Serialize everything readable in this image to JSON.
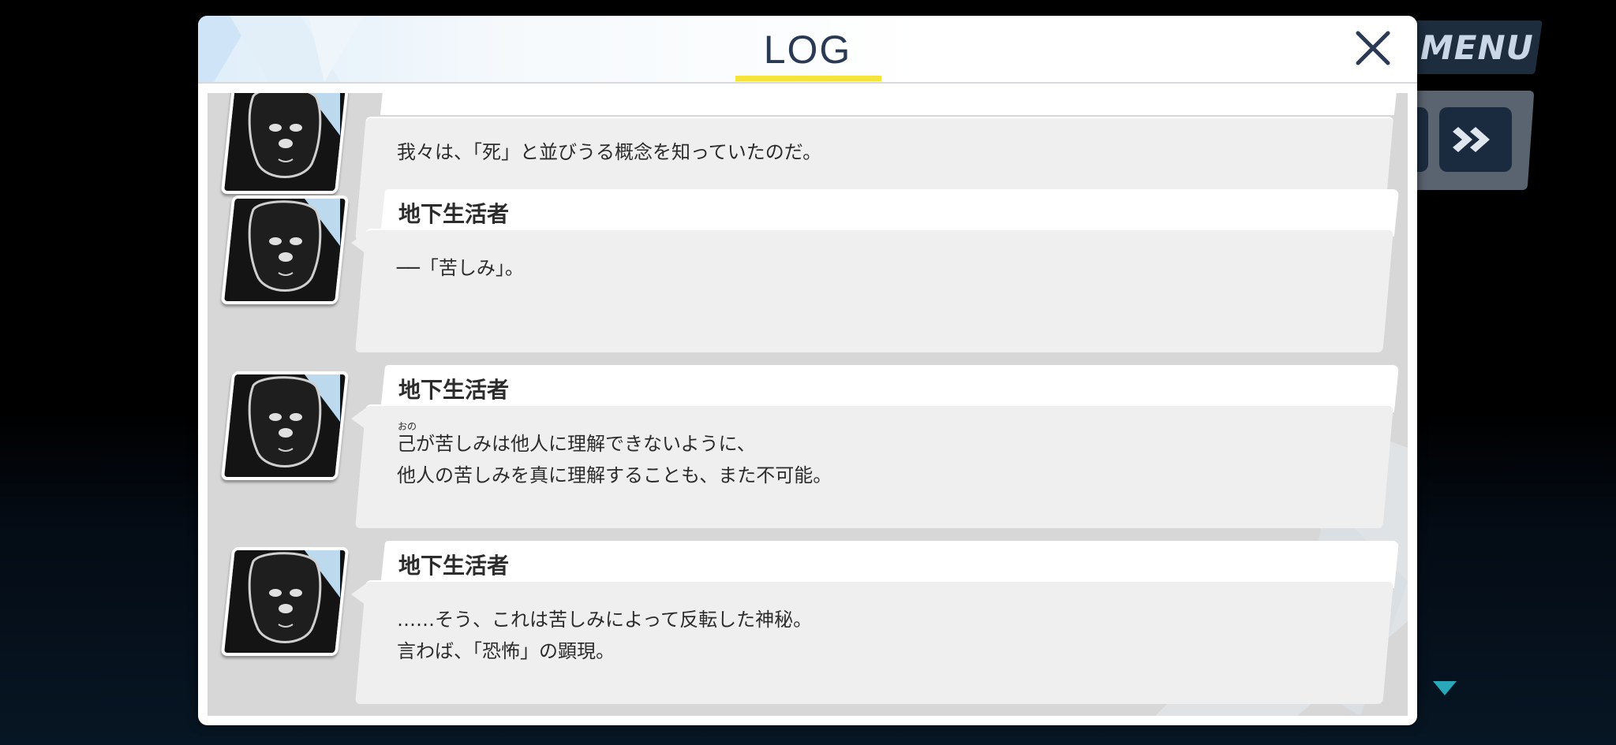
{
  "background": {
    "menu_label": "MENU",
    "fast_forward_icon": "double-chevron-right-icon"
  },
  "log": {
    "title": "LOG",
    "close_icon": "close-icon",
    "accent_color": "#f6e43a",
    "title_color": "#2a3a55",
    "entries": [
      {
        "speaker": "",
        "lines": [
          "我々は、「死」と並びうる概念を知っていたのだ。"
        ]
      },
      {
        "speaker": "地下生活者",
        "lines": [
          "──「苦しみ」。"
        ]
      },
      {
        "speaker": "地下生活者",
        "ruby": "おの",
        "lines": [
          "己が苦しみは他人に理解できないように、",
          "他人の苦しみを真に理解することも、また不可能。"
        ]
      },
      {
        "speaker": "地下生活者",
        "lines": [
          "……そう、これは苦しみによって反転した神秘。",
          "言わば、「恐怖」の顕現。"
        ]
      }
    ]
  }
}
